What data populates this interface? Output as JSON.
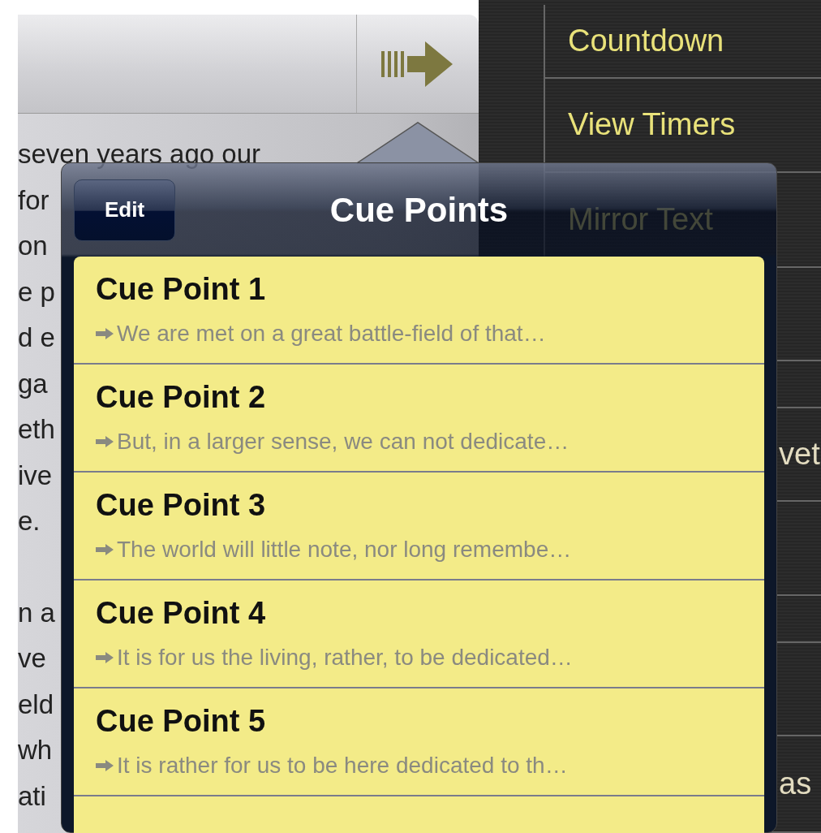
{
  "script": {
    "paragraphs": [
      [
        "seven years ago our",
        "for",
        "on",
        "e p",
        "d e",
        "ga",
        "eth",
        "ive",
        "e."
      ],
      [
        "n a",
        "ve",
        "eld",
        "wh",
        "ati"
      ]
    ]
  },
  "menu": {
    "items": [
      {
        "label": "Countdown"
      },
      {
        "label": "View Timers"
      },
      {
        "label": "Mirror Text"
      },
      {
        "label": "vet"
      },
      {
        "label": "as"
      }
    ]
  },
  "popover": {
    "title": "Cue Points",
    "edit_button": "Edit",
    "cue_points": [
      {
        "title": "Cue Point 1",
        "preview": "We are met on a great battle-field of that…"
      },
      {
        "title": "Cue Point 2",
        "preview": "But, in a larger sense, we can not dedicate…"
      },
      {
        "title": "Cue Point 3",
        "preview": "The world will little note, nor long remembe…"
      },
      {
        "title": "Cue Point 4",
        "preview": "It is for us the living, rather, to be dedicated…"
      },
      {
        "title": "Cue Point 5",
        "preview": "It is rather for us to be here dedicated to th…"
      }
    ]
  }
}
